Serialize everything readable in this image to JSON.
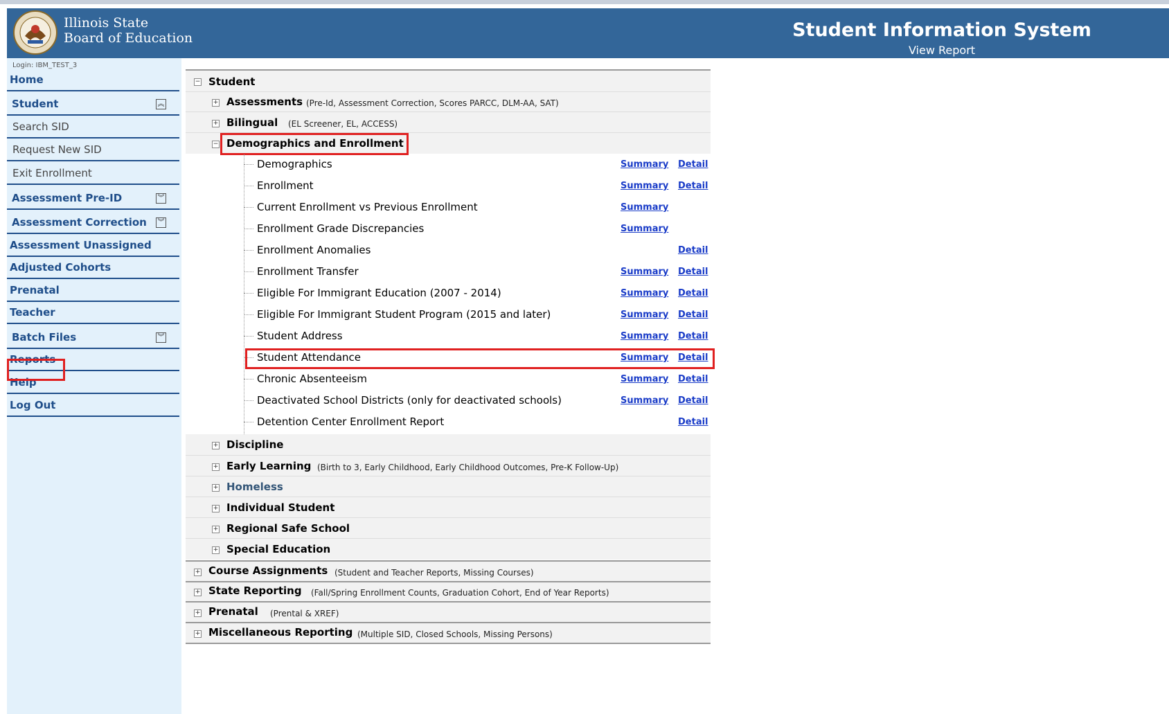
{
  "header": {
    "logo_line1": "Illinois State",
    "logo_line2": "Board of Education",
    "title": "Student Information System",
    "subtitle": "View Report"
  },
  "sidebar": {
    "login": "Login: IBM_TEST_3",
    "items": [
      {
        "label": "Home"
      },
      {
        "label": "Student"
      },
      {
        "label": "Search SID"
      },
      {
        "label": "Request New SID"
      },
      {
        "label": "Exit Enrollment"
      },
      {
        "label": "Assessment Pre-ID"
      },
      {
        "label": "Assessment Correction"
      },
      {
        "label": "Assessment Unassigned"
      },
      {
        "label": "Adjusted Cohorts"
      },
      {
        "label": "Prenatal"
      },
      {
        "label": "Teacher"
      },
      {
        "label": "Batch Files"
      },
      {
        "label": "Reports"
      },
      {
        "label": "Help"
      },
      {
        "label": "Log Out"
      }
    ]
  },
  "tree": {
    "root": "Student",
    "student_groups": [
      {
        "label": "Assessments",
        "desc": "(Pre-Id, Assessment Correction, Scores PARCC, DLM-AA, SAT)"
      },
      {
        "label": "Bilingual",
        "desc": "(EL Screener, EL, ACCESS)"
      },
      {
        "label": "Demographics and Enrollment",
        "desc": ""
      }
    ],
    "demographics_items": [
      {
        "label": "Demographics",
        "summary": "Summary",
        "detail": "Detail"
      },
      {
        "label": "Enrollment",
        "summary": "Summary",
        "detail": "Detail"
      },
      {
        "label": "Current Enrollment vs Previous Enrollment",
        "summary": "Summary",
        "detail": ""
      },
      {
        "label": "Enrollment Grade Discrepancies",
        "summary": "Summary",
        "detail": ""
      },
      {
        "label": "Enrollment Anomalies",
        "summary": "",
        "detail": "Detail"
      },
      {
        "label": "Enrollment Transfer",
        "summary": "Summary",
        "detail": "Detail"
      },
      {
        "label": "Eligible For Immigrant Education (2007 - 2014)",
        "summary": "Summary",
        "detail": "Detail"
      },
      {
        "label": "Eligible For Immigrant Student Program (2015 and later)",
        "summary": "Summary",
        "detail": "Detail"
      },
      {
        "label": "Student Address",
        "summary": "Summary",
        "detail": "Detail"
      },
      {
        "label": "Student Attendance",
        "summary": "Summary",
        "detail": "Detail"
      },
      {
        "label": "Chronic Absenteeism",
        "summary": "Summary",
        "detail": "Detail"
      },
      {
        "label": "Deactivated School Districts (only for deactivated schools)",
        "summary": "Summary",
        "detail": "Detail"
      },
      {
        "label": "Detention Center Enrollment Report",
        "summary": "",
        "detail": "Detail"
      }
    ],
    "more_student_groups": [
      {
        "label": "Discipline",
        "desc": ""
      },
      {
        "label": "Early Learning",
        "desc": "(Birth to 3, Early Childhood, Early Childhood Outcomes, Pre-K Follow-Up)"
      },
      {
        "label": "Homeless",
        "desc": ""
      },
      {
        "label": "Individual Student",
        "desc": ""
      },
      {
        "label": "Regional Safe School",
        "desc": ""
      },
      {
        "label": "Special Education",
        "desc": ""
      }
    ],
    "top_groups": [
      {
        "label": "Course Assignments",
        "desc": "(Student and Teacher Reports, Missing Courses)"
      },
      {
        "label": "State Reporting",
        "desc": "(Fall/Spring Enrollment Counts, Graduation Cohort, End of Year Reports)"
      },
      {
        "label": "Prenatal",
        "desc": "(Prental & XREF)"
      },
      {
        "label": "Miscellaneous Reporting",
        "desc": "(Multiple SID, Closed Schools, Missing Persons)"
      }
    ]
  }
}
